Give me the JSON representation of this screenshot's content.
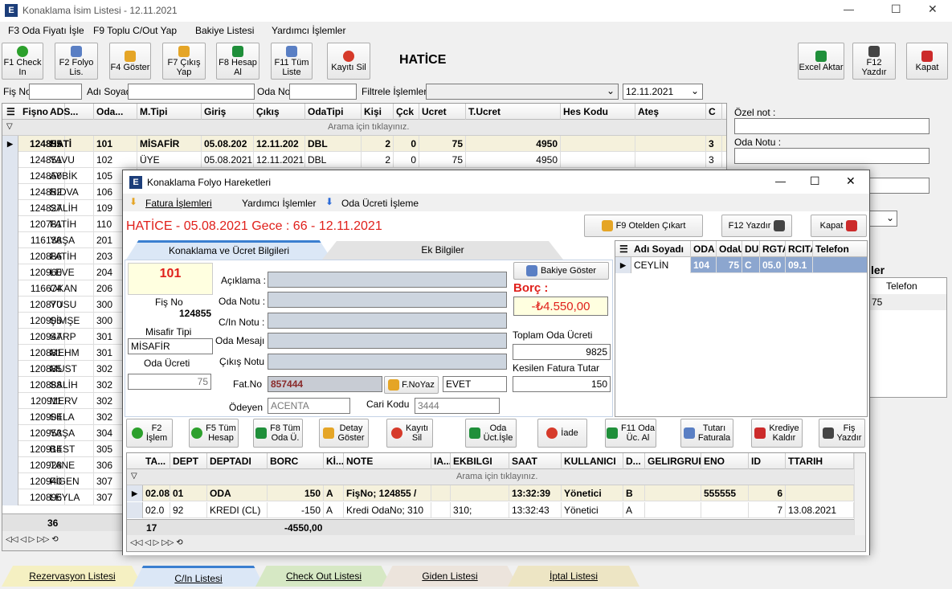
{
  "window": {
    "title": "Konaklama İsim Listesi - 12.11.2021",
    "minimize": "—",
    "maximize": "☐",
    "close": "✕"
  },
  "menu": [
    "F3 Oda Fiyatı İşle",
    "F9  Toplu C/Out Yap",
    "Bakiye Listesi",
    "Yardımcı İşlemler"
  ],
  "toolbar": [
    {
      "label": "F1 Check\nIn",
      "icon": "add-icon"
    },
    {
      "label": "F2 Folyo\nLis.",
      "icon": "search-icon"
    },
    {
      "label": "F4 Göster",
      "icon": "show-icon"
    },
    {
      "label": "F7 Çıkış\nYap",
      "icon": "exit-icon"
    },
    {
      "label": "F8 Hesap\nAl",
      "icon": "account-icon"
    },
    {
      "label": "F11 Tüm\nListe",
      "icon": "list-icon"
    },
    {
      "label": "Kayıtı Sil",
      "icon": "delete-icon"
    }
  ],
  "guest_name": "HATİCE",
  "right_toolbar": [
    {
      "label": "Excel Aktar",
      "icon": "excel-icon"
    },
    {
      "label": "F12 Yazdır",
      "icon": "printer-icon"
    },
    {
      "label": "Kapat",
      "icon": "close-icon"
    }
  ],
  "filter": {
    "fis_no_label": "Fiş No",
    "adi_soyadi_label": "Adı Soyadı",
    "oda_no_label": "Oda No",
    "filtrele_label": "Filtrele İşlemleri :",
    "date": "12.11.2021"
  },
  "main_grid": {
    "columns": [
      "Fişno",
      "ADS...",
      "Oda...",
      "M.Tipi",
      "Giriş",
      "Çıkış",
      "OdaTipi",
      "Kişi",
      "Çck",
      "Ucret",
      "T.Ucret",
      "Hes Kodu",
      "Ateş",
      "C"
    ],
    "search_hint": "Arama için tıklayınız.",
    "rows": [
      [
        "124855",
        "HATİ",
        "101",
        "MİSAFİR",
        "05.08.202",
        "12.11.202",
        "DBL",
        "2",
        "0",
        "75",
        "4950",
        "",
        "",
        "3"
      ],
      [
        "124851",
        "YAVU",
        "102",
        "ÜYE",
        "05.08.2021",
        "12.11.2021",
        "DBL",
        "2",
        "0",
        "75",
        "4950",
        "",
        "",
        "3"
      ],
      [
        "124850",
        "AYBİK",
        "105"
      ],
      [
        "124852",
        "RIDVA",
        "106"
      ],
      [
        "124827",
        "SALİH",
        "109"
      ],
      [
        "120781",
        "FATİH",
        "110"
      ],
      [
        "116138",
        "YAŞA",
        "201"
      ],
      [
        "120886",
        "FATİH",
        "203"
      ],
      [
        "120960",
        "LEVE",
        "204"
      ],
      [
        "116674",
        "OKAN",
        "206"
      ],
      [
        "120870",
        "YUSU",
        "300"
      ],
      [
        "120905",
        "ŞİMŞE",
        "300"
      ],
      [
        "120947",
        "SARP",
        "301"
      ],
      [
        "120881",
        "MEHM",
        "301"
      ],
      [
        "120885",
        "MUST",
        "302"
      ],
      [
        "120888",
        "SALİH",
        "302"
      ],
      [
        "120911",
        "MERV",
        "302"
      ],
      [
        "120904",
        "SELA",
        "302"
      ],
      [
        "120953",
        "YAŞA",
        "304"
      ],
      [
        "120914",
        "BEST",
        "305"
      ],
      [
        "120928",
        "TANE",
        "306"
      ],
      [
        "120940",
        "FİGEN",
        "307"
      ],
      [
        "120896",
        "LEYLA",
        "307"
      ]
    ],
    "count": "36"
  },
  "side": {
    "ozel_not": "Özel not :",
    "oda_notu": "Oda Notu :",
    "partial_title": "ler",
    "telefon": "Telefon",
    "value": "75"
  },
  "dialog": {
    "title": "Konaklama Folyo Hareketleri",
    "menu": [
      "Fatura İşlemleri",
      "Yardımcı İşlemler",
      "Oda Ücreti İşleme"
    ],
    "header_text": "HATİCE   - 05.08.2021 Gece : 66 - 12.11.2021",
    "btn_otelden": "F9 Otelden Çıkart",
    "btn_yazdir": "F12 Yazdır",
    "btn_kapat": "Kapat",
    "tabs": [
      "Konaklama ve Ücret Bilgileri",
      "Ek Bilgiler"
    ],
    "room": "101",
    "fis_no_label": "Fiş No",
    "fis_no": "124855",
    "misafir_tipi_label": "Misafir Tipi",
    "misafir_tipi": "MİSAFİR",
    "oda_ucreti_label": "Oda Ücreti",
    "oda_ucreti": "75",
    "fields": [
      "Açıklama :",
      "Oda Notu :",
      "C/In Notu :",
      "Oda Mesajı",
      "Çıkış Notu"
    ],
    "fatno_label": "Fat.No",
    "fatno": "857444",
    "fnoyaz": "F.NoYaz",
    "evet": "EVET",
    "odeyen_label": "Ödeyen",
    "odeyen": "ACENTA",
    "cari_label": "Cari Kodu",
    "cari": "3444",
    "bakiye_btn": "Bakiye Göster",
    "borc_label": "Borç :",
    "borc": "-₺4.550,00",
    "toplam_label": "Toplam Oda Ücreti",
    "toplam": "9825",
    "kesilen_label": "Kesilen Fatura Tutar",
    "kesilen": "150",
    "guest_grid": {
      "columns": [
        "Adı Soyadı",
        "ODA",
        "OdaU",
        "DU",
        "RGTA",
        "RCITA",
        "Telefon"
      ],
      "row": [
        "CEYLİN",
        "104",
        "75",
        "C",
        "05.0",
        "09.1",
        ""
      ]
    },
    "actions": [
      "F2\nİşlem",
      "F5 Tüm\nHesap",
      "F8 Tüm\nOda Ü.",
      "Detay\nGöster",
      "Kayıtı\nSil",
      "Oda\nÜct.İşle",
      "İade",
      "F11 Oda\nÜc. Al",
      "Tutarı\nFaturala",
      "Krediye\nKaldır",
      "Fiş\nYazdır"
    ],
    "tx_grid": {
      "columns": [
        "TA...",
        "DEPT",
        "DEPTADI",
        "BORC",
        "Kİ...",
        "NOTE",
        "IA...",
        "EKBILGI",
        "SAAT",
        "KULLANICI",
        "D...",
        "GELIRGRUP",
        "ENO",
        "ID",
        "TTARIH"
      ],
      "search_hint": "Arama için tıklayınız.",
      "rows": [
        [
          "02.08.",
          "01",
          "ODA",
          "150",
          "A",
          "FişNo; 124855 /",
          "",
          "",
          "13:32:39",
          "Yönetici",
          "B",
          "",
          "555555",
          "6",
          ""
        ],
        [
          "02.0",
          "92",
          "KREDI (CL)",
          "-150",
          "A",
          "Kredi OdaNo; 310",
          "",
          "310;",
          "13:32:43",
          "Yönetici",
          "A",
          "",
          "",
          "7",
          "13.08.2021"
        ]
      ],
      "count": "17",
      "total": "-4550,00"
    }
  },
  "bottom_tabs": [
    "Rezervasyon Listesi",
    "C/In Listesi",
    "Check Out Listesi",
    "Giden Listesi",
    "İptal Listesi"
  ],
  "colors": {
    "accent_red": "#e0201b",
    "selected_row": "#f5f1dc",
    "tab_active": "#dbe7f6"
  }
}
